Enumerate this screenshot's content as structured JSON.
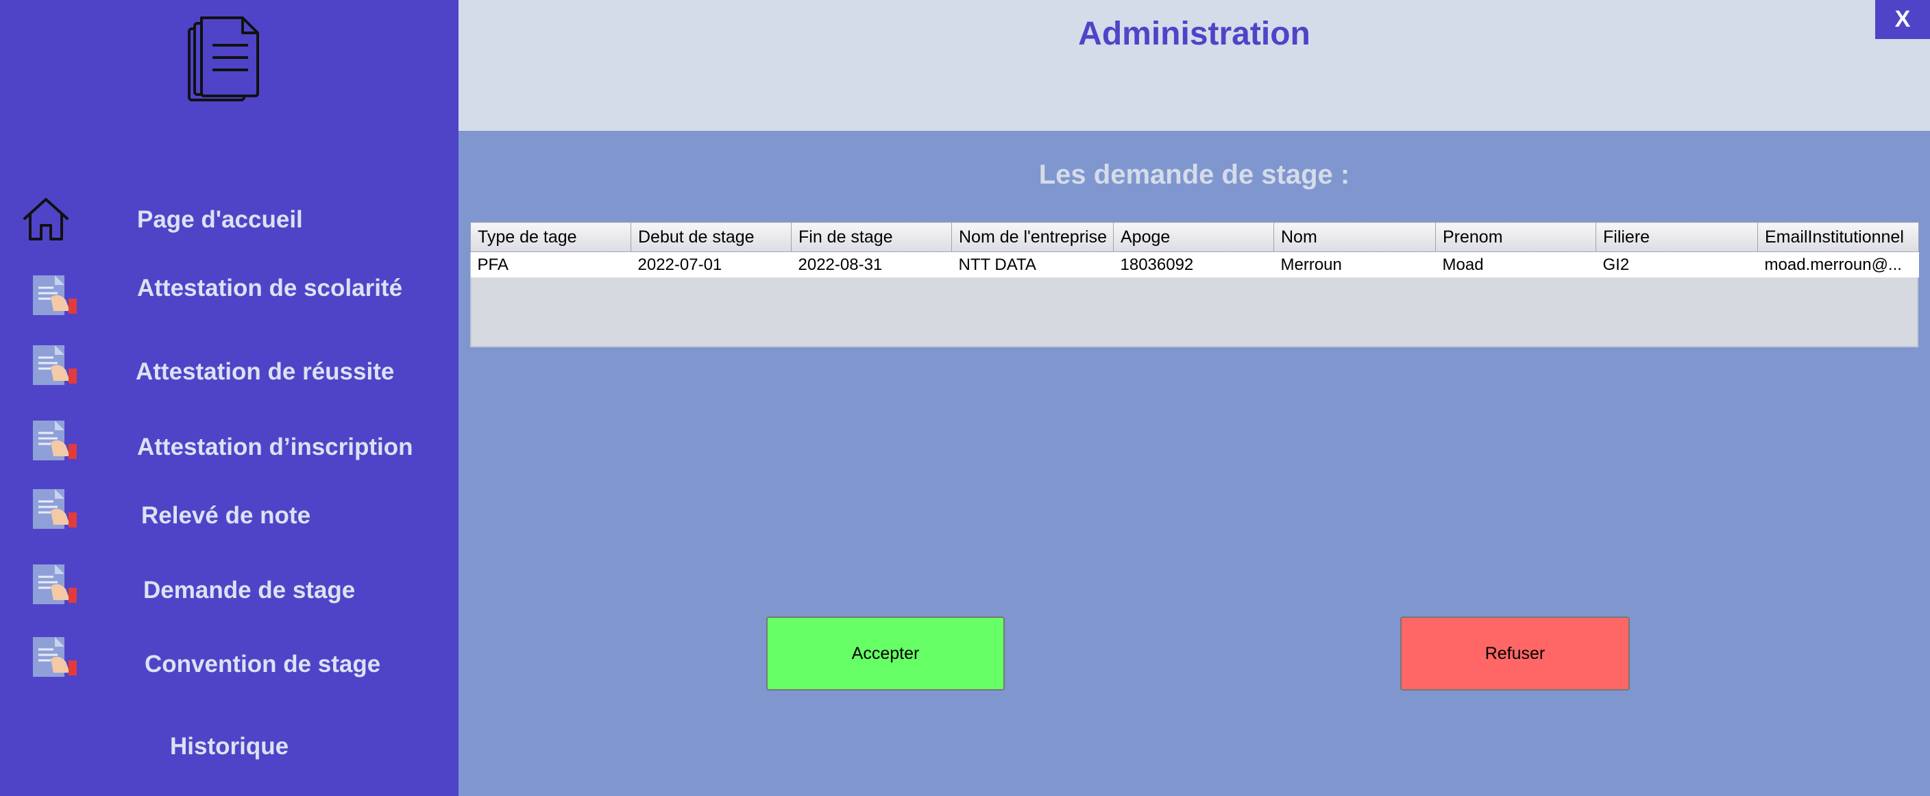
{
  "window": {
    "title": "Administration",
    "close_label": "X"
  },
  "sidebar": {
    "logo_icon": "documents-icon",
    "items": [
      {
        "label": "Page d'accueil",
        "icon": "home-icon"
      },
      {
        "label": "Attestation de scolarité",
        "icon": "document-hand-icon"
      },
      {
        "label": "Attestation de réussite",
        "icon": "document-hand-icon"
      },
      {
        "label": "Attestation d’inscription",
        "icon": "document-hand-icon"
      },
      {
        "label": "Relevé de note",
        "icon": "document-hand-icon"
      },
      {
        "label": "Demande de stage",
        "icon": "document-hand-icon"
      },
      {
        "label": "Convention de stage",
        "icon": "document-hand-icon"
      },
      {
        "label": "Historique",
        "icon": ""
      }
    ]
  },
  "main": {
    "section_title": "Les demande de stage :",
    "table": {
      "columns": [
        "Type de tage",
        "Debut de stage",
        "Fin de stage",
        "Nom de l'entreprise",
        "Apoge",
        "Nom",
        "Prenom",
        "Filiere",
        "EmailInstitutionnel"
      ],
      "rows": [
        [
          "PFA",
          "2022-07-01",
          "2022-08-31",
          "NTT DATA",
          "18036092",
          "Merroun",
          "Moad",
          "GI2",
          "moad.merroun@..."
        ]
      ]
    },
    "accept_label": "Accepter",
    "refuse_label": "Refuser"
  },
  "colors": {
    "sidebar": "#4f44c8",
    "header": "#d5dce9",
    "content": "#7f96cf",
    "accept": "#66ff66",
    "refuse": "#ff6666"
  }
}
